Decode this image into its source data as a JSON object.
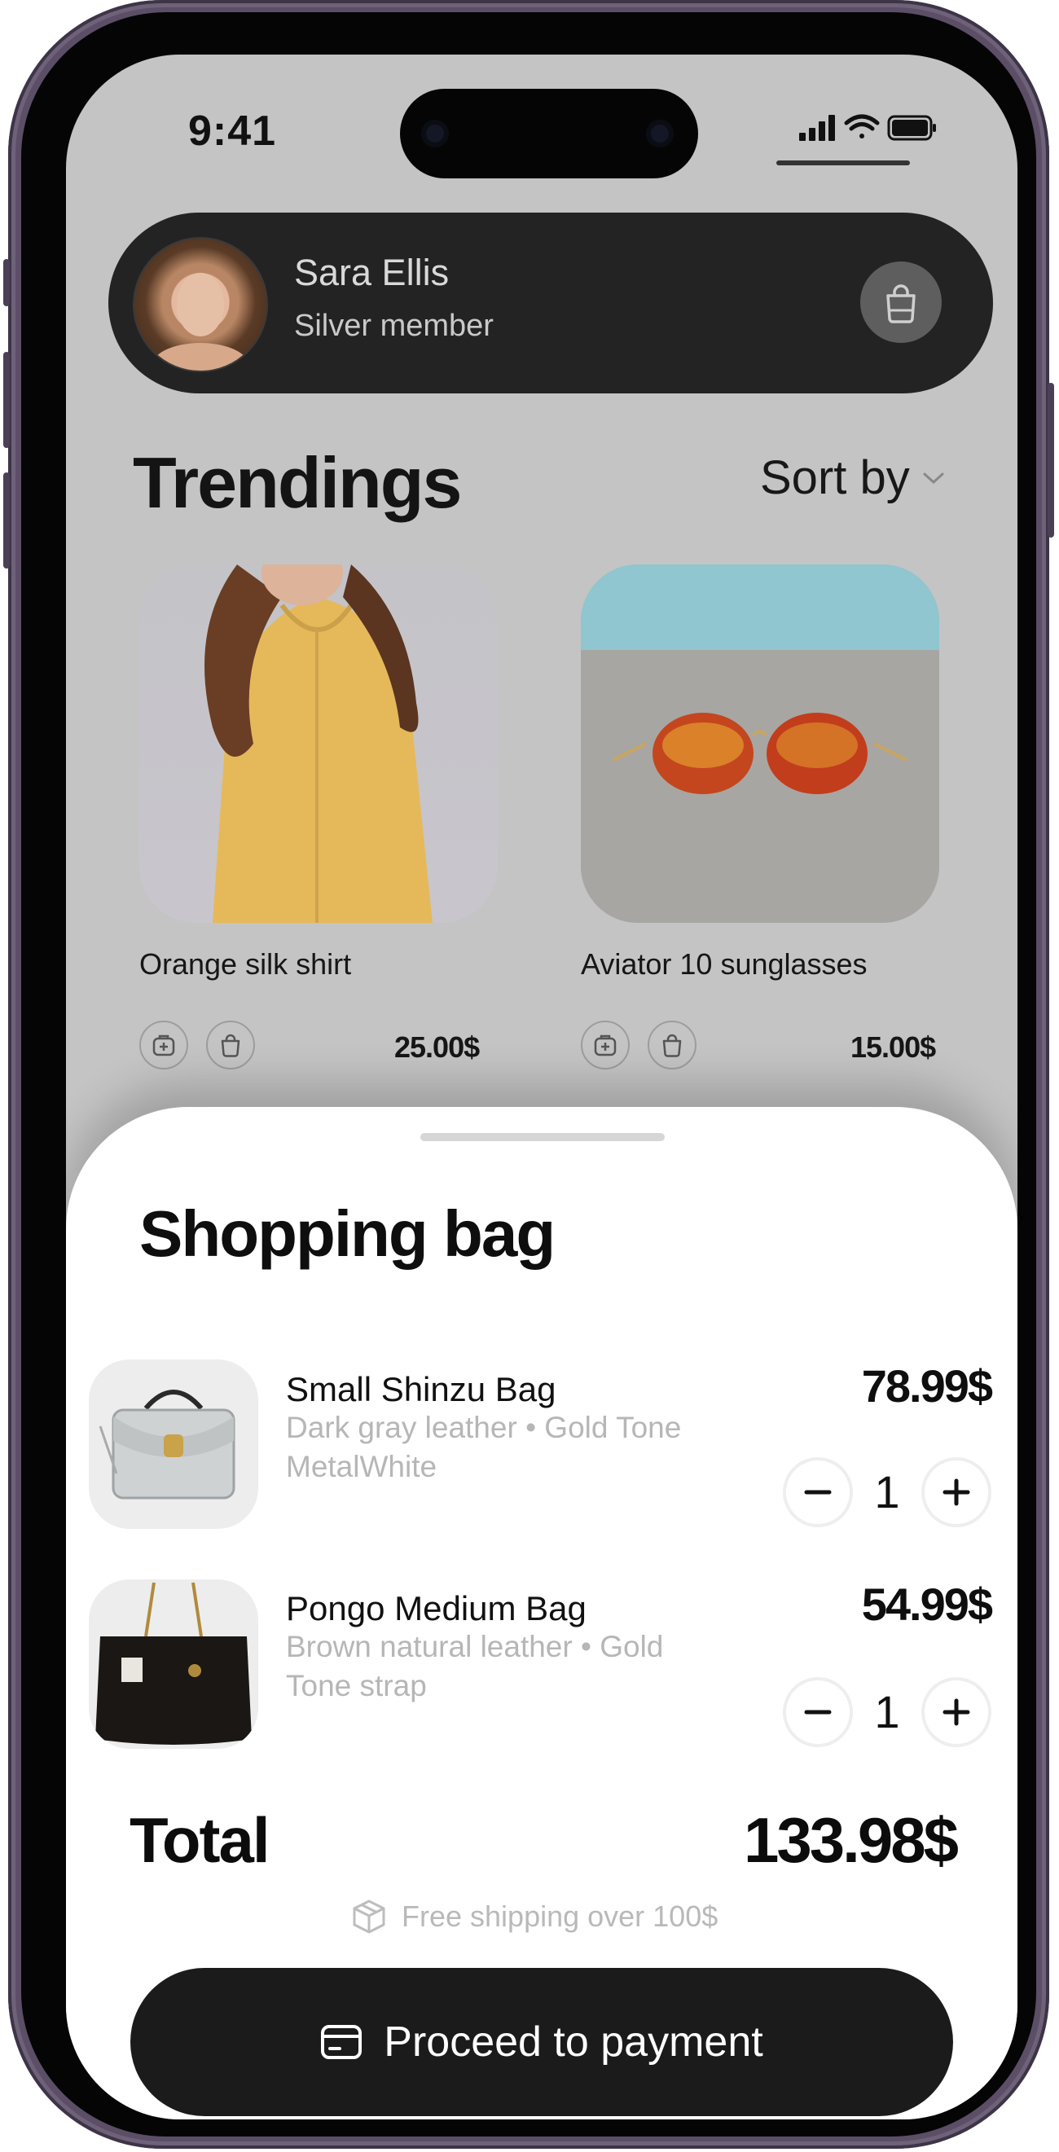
{
  "status_bar": {
    "time": "9:41"
  },
  "profile": {
    "name": "Sara Ellis",
    "level": "Silver member"
  },
  "trending": {
    "title": "Trendings",
    "sort_label": "Sort by",
    "products": [
      {
        "name": "Orange silk shirt",
        "price": "25.00$"
      },
      {
        "name": "Aviator 10 sunglasses",
        "price": "15.00$"
      }
    ]
  },
  "bag": {
    "title": "Shopping bag",
    "items": [
      {
        "name": "Small Shinzu Bag",
        "desc": "Dark gray leather • Gold Tone MetalWhite",
        "price": "78.99$",
        "qty": "1"
      },
      {
        "name": "Pongo Medium Bag",
        "desc": "Brown natural leather • Gold Tone strap",
        "price": "54.99$",
        "qty": "1"
      }
    ],
    "total_label": "Total",
    "total_value": "133.98$",
    "shipping_note": "Free shipping over 100$",
    "pay_label": "Proceed to payment"
  },
  "colors": {
    "frame": "#5b4e66",
    "dark": "#232323",
    "sheet": "#ffffff",
    "screen_bg": "#c4c4c4"
  },
  "icons": [
    "shopping-bag-icon",
    "chevron-down-icon",
    "add-to-cart-icon",
    "minus-icon",
    "plus-icon",
    "box-icon",
    "credit-card-icon",
    "signal-icon",
    "wifi-icon",
    "battery-icon"
  ]
}
